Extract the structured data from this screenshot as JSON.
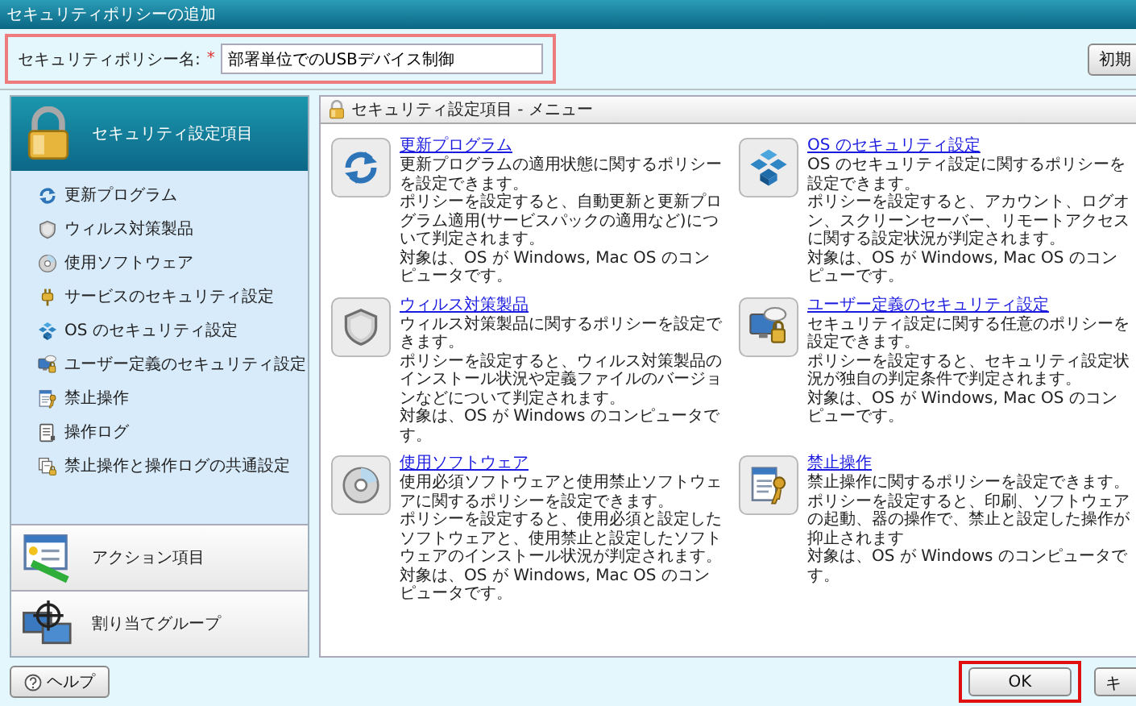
{
  "window": {
    "title": "セキュリティポリシーの追加"
  },
  "name_field": {
    "label": "セキュリティポリシー名:",
    "required_mark": "*",
    "value": "部署単位でのUSBデバイス制御",
    "highlighted": true
  },
  "top_button": {
    "label": "初期"
  },
  "sidebar": {
    "sections": [
      {
        "label": "セキュリティ設定項目",
        "selected": true,
        "items": [
          "更新プログラム",
          "ウィルス対策製品",
          "使用ソフトウェア",
          "サービスのセキュリティ設定",
          "OS のセキュリティ設定",
          "ユーザー定義のセキュリティ設定",
          "禁止操作",
          "操作ログ",
          "禁止操作と操作ログの共通設定"
        ]
      },
      {
        "label": "アクション項目",
        "selected": false
      },
      {
        "label": "割り当てグループ",
        "selected": false
      }
    ]
  },
  "menu": {
    "title": "セキュリティ設定項目 - メニュー",
    "cards": [
      {
        "title": "更新プログラム",
        "paragraphs": [
          "更新プログラムの適用状態に関するポリシーを設定できます。",
          "ポリシーを設定すると、自動更新と更新プログラム適用(サービスパックの適用など)について判定されます。",
          "対象は、OS が Windows, Mac OS のコンピュータです。"
        ]
      },
      {
        "title": "OS のセキュリティ設定",
        "paragraphs": [
          "OS のセキュリティ設定に関するポリシーを設定できます。",
          "ポリシーを設定すると、アカウント、ログオン、スクリーンセーバー、リモートアクセスに関する設定状況が判定されます。",
          "対象は、OS が Windows, Mac OS のコンピューです。"
        ]
      },
      {
        "title": "ウィルス対策製品",
        "paragraphs": [
          "ウィルス対策製品に関するポリシーを設定できます。",
          "ポリシーを設定すると、ウィルス対策製品のインストール状況や定義ファイルのバージョンなどについて判定されます。",
          "対象は、OS が Windows のコンピュータです。"
        ]
      },
      {
        "title": "ユーザー定義のセキュリティ設定",
        "paragraphs": [
          "セキュリティ設定に関する任意のポリシーを設定できます。",
          "ポリシーを設定すると、セキュリティ設定状況が独自の判定条件で判定されます。",
          "対象は、OS が Windows, Mac OS のコンピューです。"
        ]
      },
      {
        "title": "使用ソフトウェア",
        "paragraphs": [
          "使用必須ソフトウェアと使用禁止ソフトウェアに関するポリシーを設定できます。",
          "ポリシーを設定すると、使用必須と設定したソフトウェアと、使用禁止と設定したソフトウェアのインストール状況が判定されます。",
          "対象は、OS が Windows, Mac OS のコンピュータです。"
        ]
      },
      {
        "title": "禁止操作",
        "paragraphs": [
          "禁止操作に関するポリシーを設定できます。",
          "ポリシーを設定すると、印刷、ソフトウェアの起動、器の操作で、禁止と設定した操作が抑止されます",
          "対象は、OS が Windows のコンピュータです。"
        ]
      }
    ]
  },
  "footer": {
    "help_button": "ヘルプ",
    "buttons": [
      {
        "label": "OK",
        "highlighted": true
      },
      {
        "label": "キ",
        "highlighted": false
      }
    ]
  }
}
